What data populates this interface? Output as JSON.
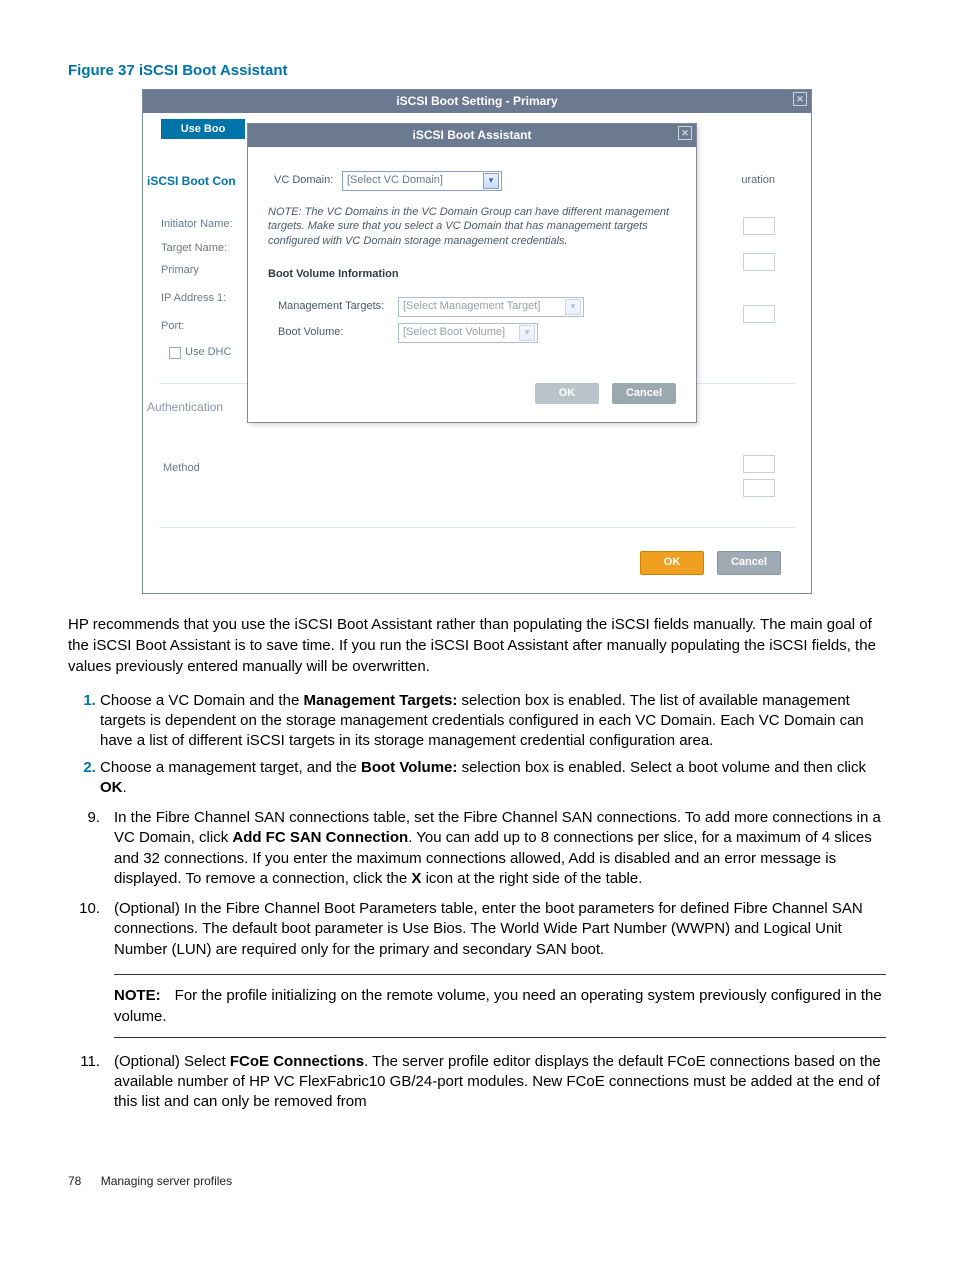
{
  "figure": {
    "caption": "Figure 37 iSCSI Boot Assistant"
  },
  "outerDialog": {
    "title": "iSCSI Boot Setting - Primary",
    "tabLabel": "Use Boo",
    "sectionHeading": "iSCSI Boot Con",
    "rightPartialText": "uration",
    "labels": {
      "initiator": "Initiator Name:",
      "target": "Target Name:",
      "primary": "Primary",
      "ip": "IP Address 1:",
      "port": "Port:",
      "useDhcp": "Use DHC",
      "auth": "Authentication",
      "method": "Method"
    },
    "buttons": {
      "ok": "OK",
      "cancel": "Cancel"
    }
  },
  "innerDialog": {
    "title": "iSCSI Boot Assistant",
    "vcDomain": {
      "label": "VC Domain:",
      "placeholder": "[Select VC Domain]"
    },
    "note": "NOTE: The VC Domains in the VC Domain Group can have different management targets. Make sure that you select a VC Domain that has management targets configured with VC Domain storage management credentials.",
    "section": "Boot Volume Information",
    "mgmtTargets": {
      "label": "Management Targets:",
      "placeholder": "[Select Management Target]"
    },
    "bootVolume": {
      "label": "Boot Volume:",
      "placeholder": "[Select Boot Volume]"
    },
    "buttons": {
      "ok": "OK",
      "cancel": "Cancel"
    }
  },
  "body": {
    "p1": "HP recommends that you use the iSCSI Boot Assistant rather than populating the iSCSI fields manually. The main goal of the iSCSI Boot Assistant is to save time. If you run the iSCSI Boot Assistant after manually populating the iSCSI fields, the values previously entered manually will be overwritten.",
    "sub1_a": "Choose a VC Domain and the ",
    "sub1_bold": "Management Targets:",
    "sub1_b": " selection box is enabled. The list of available management targets is dependent on the storage management credentials configured in each VC Domain. Each VC Domain can have a list of different iSCSI targets in its storage management credential configuration area.",
    "sub2_a": "Choose a management target, and the ",
    "sub2_bold": "Boot Volume:",
    "sub2_b": " selection box is enabled. Select a boot volume and then click ",
    "sub2_ok": "OK",
    "sub2_c": ".",
    "step9_num": "9.",
    "step9_a": "In the Fibre Channel SAN connections table, set the Fibre Channel SAN connections. To add more connections in a VC Domain, click ",
    "step9_bold": "Add FC SAN Connection",
    "step9_b": ". You can add up to 8 connections per slice, for a maximum of 4 slices and 32 connections. If you enter the maximum connections allowed, Add is disabled and an error message is displayed. To remove a connection, click the ",
    "step9_x": "X",
    "step9_c": " icon at the right side of the table.",
    "step10_num": "10.",
    "step10": "(Optional) In the Fibre Channel Boot Parameters table, enter the boot parameters for defined Fibre Channel SAN connections. The default boot parameter is Use Bios. The World Wide Part Number (WWPN) and Logical Unit Number (LUN) are required only for the primary and secondary SAN boot.",
    "noteLabel": "NOTE:",
    "noteText": "For the profile initializing on the remote volume, you need an operating system previously configured in the volume.",
    "step11_num": "11.",
    "step11_a": "(Optional) Select ",
    "step11_bold": "FCoE Connections",
    "step11_b": ". The server profile editor displays the default FCoE connections based on the available number of HP VC FlexFabric10 GB/24-port modules. New FCoE connections must be added at the end of this list and can only be removed from"
  },
  "footer": {
    "pageNum": "78",
    "section": "Managing server profiles"
  }
}
